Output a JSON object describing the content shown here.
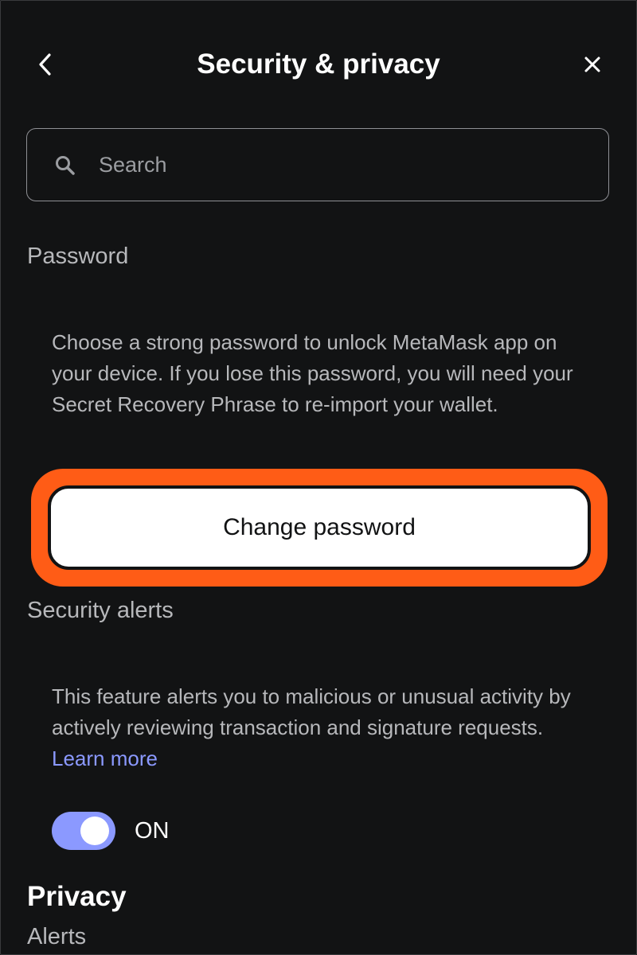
{
  "header": {
    "title": "Security & privacy"
  },
  "search": {
    "placeholder": "Search"
  },
  "password": {
    "label": "Password",
    "description": "Choose a strong password to unlock MetaMask app on your device. If you lose this password, you will need your Secret Recovery Phrase to re-import your wallet.",
    "button_label": "Change password"
  },
  "security_alerts": {
    "label": "Security alerts",
    "description": "This feature alerts you to malicious or unusual activity by actively reviewing transaction and signature requests.",
    "learn_more": "Learn more",
    "toggle_state": "ON"
  },
  "privacy": {
    "heading": "Privacy",
    "first_item": "Alerts"
  },
  "colors": {
    "background": "#121314",
    "accent": "#8b99ff",
    "highlight": "#ff5c16"
  },
  "icons": {
    "back": "chevron-left-icon",
    "close": "close-icon",
    "search": "search-icon"
  }
}
